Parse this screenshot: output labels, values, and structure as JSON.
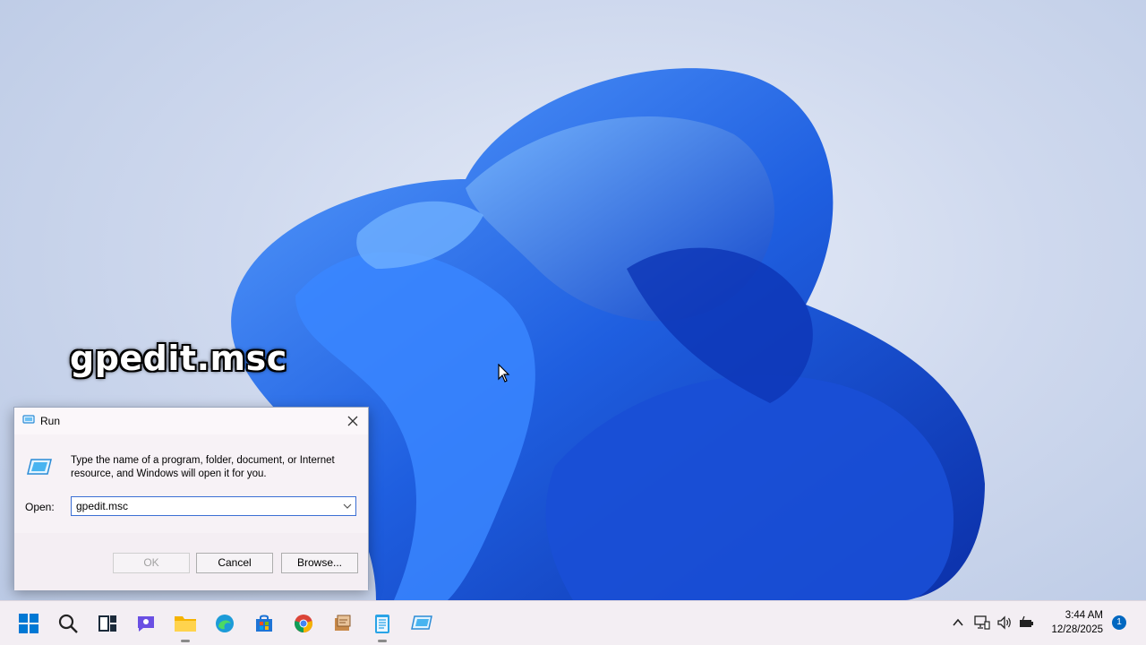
{
  "overlay": {
    "caption": "gpedit.msc"
  },
  "run_dialog": {
    "title": "Run",
    "description": "Type the name of a program, folder, document, or Internet resource, and Windows will open it for you.",
    "open_label": "Open:",
    "open_value": "gpedit.msc",
    "buttons": {
      "ok": "OK",
      "cancel": "Cancel",
      "browse": "Browse..."
    }
  },
  "taskbar": {
    "pinned_icons": [
      "start-icon",
      "search-icon",
      "task-view-icon",
      "chat-icon",
      "file-explorer-icon",
      "edge-icon",
      "store-icon",
      "chrome-icon",
      "app-icon",
      "notepad-icon",
      "run-app-icon"
    ],
    "clock": {
      "time": "3:44 AM",
      "date": "12/28/2025"
    },
    "notification_count": "1"
  },
  "colors": {
    "accent": "#0067c0",
    "wallpaper_bloom": "#1f5fe0"
  }
}
